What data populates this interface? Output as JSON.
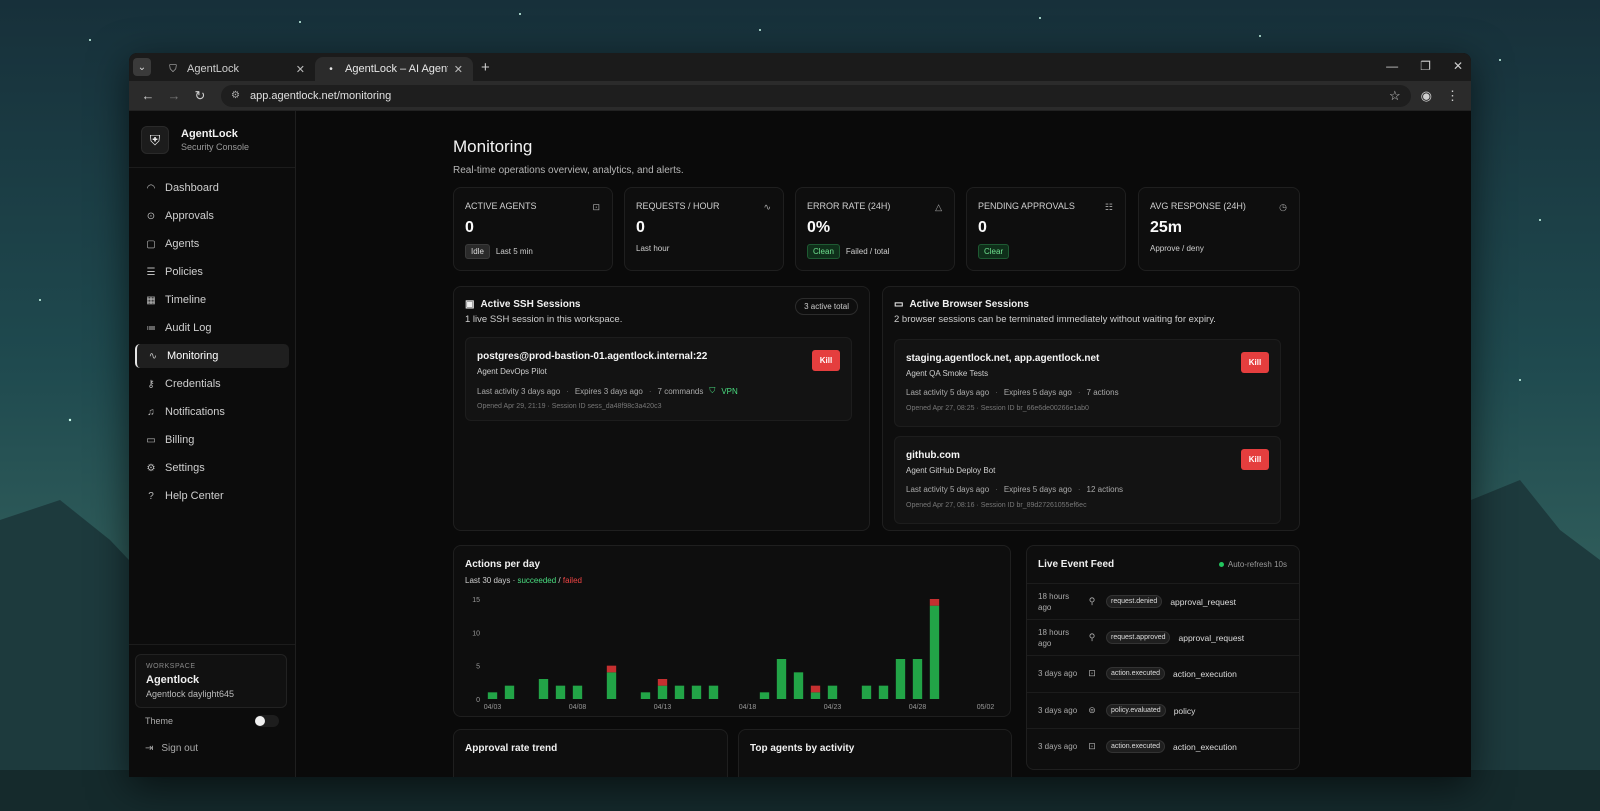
{
  "browser": {
    "tabs": [
      {
        "title": "AgentLock",
        "active": false
      },
      {
        "title": "AgentLock – AI Agent Approvals",
        "active": true
      }
    ],
    "url": "app.agentlock.net/monitoring"
  },
  "sidebar": {
    "brand_name": "AgentLock",
    "brand_sub": "Security Console",
    "items": [
      {
        "label": "Dashboard",
        "icon": "gauge-icon"
      },
      {
        "label": "Approvals",
        "icon": "check-circle-icon"
      },
      {
        "label": "Agents",
        "icon": "bot-icon"
      },
      {
        "label": "Policies",
        "icon": "sliders-icon"
      },
      {
        "label": "Timeline",
        "icon": "calendar-icon"
      },
      {
        "label": "Audit Log",
        "icon": "list-icon"
      },
      {
        "label": "Monitoring",
        "icon": "activity-icon",
        "active": true
      },
      {
        "label": "Credentials",
        "icon": "key-icon"
      },
      {
        "label": "Notifications",
        "icon": "bell-icon"
      },
      {
        "label": "Billing",
        "icon": "card-icon"
      },
      {
        "label": "Settings",
        "icon": "gear-icon"
      },
      {
        "label": "Help Center",
        "icon": "help-icon"
      }
    ],
    "workspace_label": "WORKSPACE",
    "workspace_name": "Agentlock",
    "workspace_sub": "Agentlock daylight645",
    "theme_label": "Theme",
    "signout_label": "Sign out"
  },
  "page": {
    "title": "Monitoring",
    "subtitle": "Real-time operations overview, analytics, and alerts."
  },
  "stats": [
    {
      "label": "ACTIVE AGENTS",
      "value": "0",
      "badge": "Idle",
      "badge_style": "gray",
      "foot": "Last 5 min",
      "icon": "bot-icon"
    },
    {
      "label": "REQUESTS / HOUR",
      "value": "0",
      "badge": "",
      "badge_style": "",
      "foot": "Last hour",
      "icon": "activity-icon"
    },
    {
      "label": "ERROR RATE (24H)",
      "value": "0%",
      "badge": "Clean",
      "badge_style": "green",
      "foot": "Failed / total",
      "icon": "warning-icon"
    },
    {
      "label": "PENDING APPROVALS",
      "value": "0",
      "badge": "Clear",
      "badge_style": "green",
      "foot": "",
      "icon": "list-check-icon"
    },
    {
      "label": "AVG RESPONSE (24H)",
      "value": "25m",
      "badge": "",
      "badge_style": "",
      "foot": "Approve / deny",
      "icon": "clock-icon"
    }
  ],
  "ssh": {
    "title": "Active SSH Sessions",
    "subtitle": "1 live SSH session in this workspace.",
    "pill": "3 active total",
    "sessions": [
      {
        "name": "postgres@prod-bastion-01.agentlock.internal:22",
        "agent": "Agent DevOps Pilot",
        "last_activity": "Last activity 3 days ago",
        "expires": "Expires 3 days ago",
        "count": "7 commands",
        "vpn": "VPN",
        "opened": "Opened Apr 29, 21:19 · Session ID sess_da48f98c3a420c3",
        "kill": "Kill"
      }
    ]
  },
  "browser_sessions": {
    "title": "Active Browser Sessions",
    "subtitle": "2 browser sessions can be terminated immediately without waiting for expiry.",
    "sessions": [
      {
        "name": "staging.agentlock.net, app.agentlock.net",
        "agent": "Agent QA Smoke Tests",
        "last_activity": "Last activity 5 days ago",
        "expires": "Expires 5 days ago",
        "count": "7 actions",
        "opened": "Opened Apr 27, 08:25 · Session ID br_66e6de00266e1ab0",
        "kill": "Kill"
      },
      {
        "name": "github.com",
        "agent": "Agent GitHub Deploy Bot",
        "last_activity": "Last activity 5 days ago",
        "expires": "Expires 5 days ago",
        "count": "12 actions",
        "opened": "Opened Apr 27, 08:16 · Session ID br_89d27261055ef6ec",
        "kill": "Kill"
      }
    ]
  },
  "actions_chart": {
    "title": "Actions per day",
    "sub_prefix": "Last 30 days · ",
    "sub_succeeded": "succeeded",
    "sub_sep": " / ",
    "sub_failed": "failed"
  },
  "chart_data": {
    "type": "bar",
    "stacked": true,
    "ylim": [
      0,
      15
    ],
    "yticks": [
      "0",
      "5",
      "10",
      "15"
    ],
    "xtick_labels": [
      {
        "index": 0,
        "label": "04/03"
      },
      {
        "index": 5,
        "label": "04/08"
      },
      {
        "index": 10,
        "label": "04/13"
      },
      {
        "index": 15,
        "label": "04/18"
      },
      {
        "index": 20,
        "label": "04/23"
      },
      {
        "index": 25,
        "label": "04/28"
      },
      {
        "index": 29,
        "label": "05/02"
      }
    ],
    "categories": [
      "04/03",
      "04/04",
      "04/05",
      "04/06",
      "04/07",
      "04/08",
      "04/09",
      "04/10",
      "04/11",
      "04/12",
      "04/13",
      "04/14",
      "04/15",
      "04/16",
      "04/17",
      "04/18",
      "04/19",
      "04/20",
      "04/21",
      "04/22",
      "04/23",
      "04/24",
      "04/25",
      "04/26",
      "04/27",
      "04/28",
      "04/29",
      "04/30",
      "05/01",
      "05/02"
    ],
    "series": [
      {
        "name": "succeeded",
        "color": "#22a447",
        "values": [
          1,
          2,
          0,
          3,
          2,
          2,
          0,
          4,
          0,
          1,
          2,
          2,
          2,
          2,
          0,
          0,
          1,
          6,
          4,
          1,
          2,
          0,
          2,
          2,
          6,
          6,
          14,
          0,
          0,
          0
        ]
      },
      {
        "name": "failed",
        "color": "#c53030",
        "values": [
          0,
          0,
          0,
          0,
          0,
          0,
          0,
          1,
          0,
          0,
          1,
          0,
          0,
          0,
          0,
          0,
          0,
          0,
          0,
          1,
          0,
          0,
          0,
          0,
          0,
          0,
          1,
          0,
          0,
          0
        ]
      }
    ]
  },
  "feed": {
    "title": "Live Event Feed",
    "auto_refresh": "Auto-refresh 10s",
    "events": [
      {
        "time": "18 hours ago",
        "tag": "request.denied",
        "type": "approval_request",
        "icon": "user-icon"
      },
      {
        "time": "18 hours ago",
        "tag": "request.approved",
        "type": "approval_request",
        "icon": "user-icon"
      },
      {
        "time": "3 days ago",
        "tag": "action.executed",
        "type": "action_execution",
        "icon": "bot-icon"
      },
      {
        "time": "3 days ago",
        "tag": "policy.evaluated",
        "type": "policy",
        "icon": "policy-icon"
      },
      {
        "time": "3 days ago",
        "tag": "action.executed",
        "type": "action_execution",
        "icon": "bot-icon"
      }
    ]
  },
  "bottom_cards": {
    "approval_title": "Approval rate trend",
    "top_agents_title": "Top agents by activity"
  }
}
